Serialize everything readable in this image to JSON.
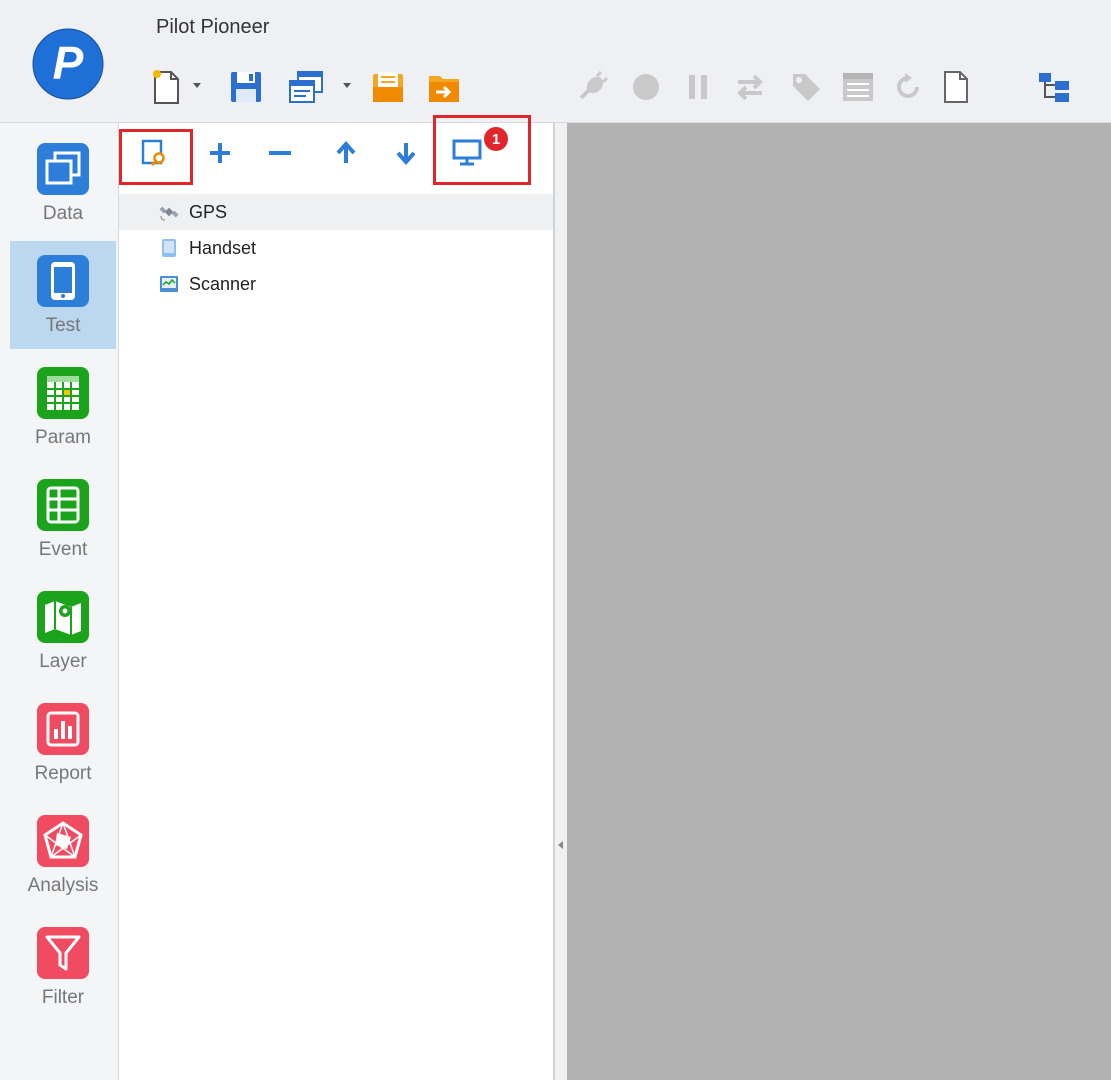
{
  "app": {
    "title": "Pilot Pioneer",
    "logo_letter": "P"
  },
  "colors": {
    "brand_blue": "#1e6fd6",
    "save_blue": "#2b6fd1",
    "folder_orange": "#f5a623",
    "nav_data_blue": "#2d7ed8",
    "nav_param_green": "#1ba41b",
    "nav_report_red": "#f04b60",
    "highlight_red": "#e0262a",
    "content_gray": "#b2b2b2"
  },
  "toolbar": {
    "new_icon": "new-document-icon",
    "save_icon": "save-icon",
    "window_icon": "window-icon",
    "open_icon": "open-folder-icon",
    "export_icon": "export-folder-icon",
    "connect_icon": "connect-plug-icon",
    "record_icon": "record-icon",
    "pause_icon": "pause-icon",
    "swap_icon": "swap-arrows-icon",
    "tag_icon": "tag-icon",
    "settings_icon": "settings-panel-icon",
    "refresh_icon": "refresh-icon",
    "page_icon": "page-icon",
    "tree_icon": "folder-tree-icon"
  },
  "nav": {
    "items": [
      {
        "label": "Data",
        "icon": "data-icon"
      },
      {
        "label": "Test",
        "icon": "test-icon"
      },
      {
        "label": "Param",
        "icon": "param-icon"
      },
      {
        "label": "Event",
        "icon": "event-icon"
      },
      {
        "label": "Layer",
        "icon": "layer-icon"
      },
      {
        "label": "Report",
        "icon": "report-icon"
      },
      {
        "label": "Analysis",
        "icon": "analysis-icon"
      },
      {
        "label": "Filter",
        "icon": "filter-icon"
      }
    ],
    "active": "Test"
  },
  "panel": {
    "badge_count": "1",
    "tree": [
      {
        "label": "GPS",
        "icon": "satellite-icon"
      },
      {
        "label": "Handset",
        "icon": "handset-icon"
      },
      {
        "label": "Scanner",
        "icon": "scanner-icon"
      }
    ]
  }
}
